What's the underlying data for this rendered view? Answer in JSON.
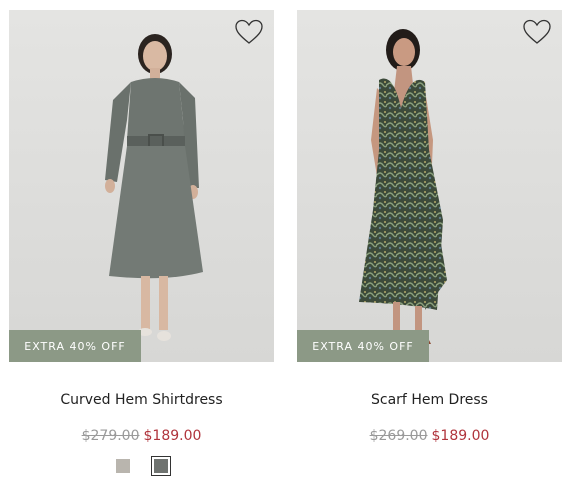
{
  "products": [
    {
      "name": "Curved Hem Shirtdress",
      "promo": "EXTRA 40% OFF",
      "price_old": "$279.00",
      "price_new": "$189.00",
      "swatches": [
        {
          "color": "#b9b5ae",
          "selected": false
        },
        {
          "color": "#6f7370",
          "selected": true
        }
      ]
    },
    {
      "name": "Scarf Hem Dress",
      "promo": "EXTRA 40% OFF",
      "price_old": "$269.00",
      "price_new": "$189.00"
    }
  ],
  "colors": {
    "promo_bg": "#8c9986",
    "sale_price": "#b0343c",
    "old_price": "#9a9a9a"
  }
}
